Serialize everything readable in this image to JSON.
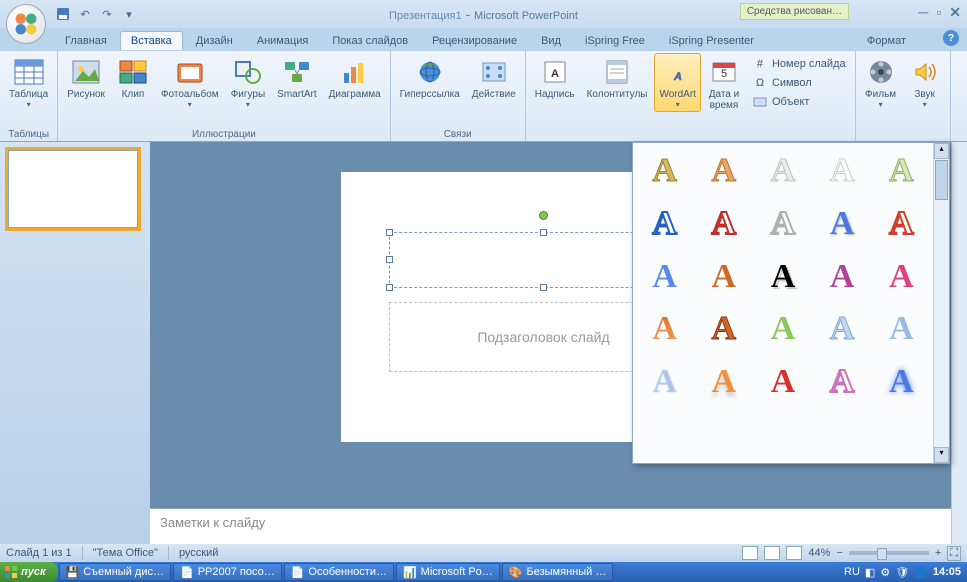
{
  "title": {
    "doc": "Презентация1",
    "app": "Microsoft PowerPoint"
  },
  "contextual_tab": "Средства рисован…",
  "tabs": [
    "Главная",
    "Вставка",
    "Дизайн",
    "Анимация",
    "Показ слайдов",
    "Рецензирование",
    "Вид",
    "iSpring Free",
    "iSpring Presenter"
  ],
  "tab_format": "Формат",
  "ribbon": {
    "tables": {
      "label": "Таблицы",
      "table": "Таблица"
    },
    "illustrations": {
      "label": "Иллюстрации",
      "pic": "Рисунок",
      "clip": "Клип",
      "album": "Фотоальбом",
      "shapes": "Фигуры",
      "smartart": "SmartArt",
      "chart": "Диаграмма"
    },
    "links": {
      "label": "Связи",
      "hyperlink": "Гиперссылка",
      "action": "Действие"
    },
    "text": {
      "textbox": "Надпись",
      "hf": "Колонтитулы",
      "wordart": "WordArt",
      "datetime": "Дата и\nвремя",
      "slidenum": "Номер слайда",
      "symbol": "Символ",
      "object": "Объект"
    },
    "media": {
      "movie": "Фильм",
      "sound": "Звук"
    }
  },
  "slide": {
    "subtitle_ph": "Подзаголовок слайд"
  },
  "notes_placeholder": "Заметки к слайду",
  "status": {
    "slide": "Слайд 1 из 1",
    "theme": "\"Тема Office\"",
    "lang": "русский",
    "zoom": "44%"
  },
  "taskbar": {
    "start": "пуск",
    "items": [
      "Съемный дис…",
      "PP2007 посо…",
      "Особенности…",
      "Microsoft Po…",
      "Безымянный …"
    ],
    "lang": "RU",
    "clock": "14:05"
  }
}
